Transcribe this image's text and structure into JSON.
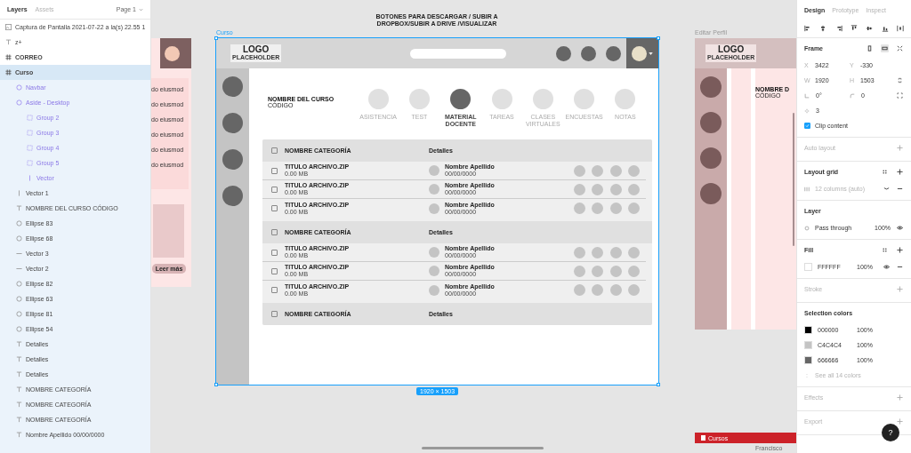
{
  "layers_panel": {
    "tabs": [
      {
        "label": "Layers",
        "selected": true
      },
      {
        "label": "Assets",
        "selected": false
      }
    ],
    "page": "Page 1",
    "layers": [
      {
        "name": "Captura de Pantalla 2021-07-22 a la(s) 22.55 1",
        "kind": "image",
        "selected": false
      },
      {
        "name": "z+",
        "kind": "text",
        "selected": false
      },
      {
        "name": "CORREO",
        "kind": "frame",
        "selected": false
      },
      {
        "name": "Curso",
        "kind": "frame",
        "selected": true,
        "children": [
          {
            "name": "Navbar",
            "kind": "component",
            "selected": false
          },
          {
            "name": "Aside - Desktop",
            "kind": "component",
            "selected": false,
            "children": [
              {
                "name": "Group 2",
                "kind": "group",
                "selected": false
              },
              {
                "name": "Group 3",
                "kind": "group",
                "selected": false
              },
              {
                "name": "Group 4",
                "kind": "group",
                "selected": false
              },
              {
                "name": "Group 5",
                "kind": "group",
                "selected": false
              },
              {
                "name": "Vector",
                "kind": "vector",
                "selected": false
              }
            ]
          },
          {
            "name": "Vector 1",
            "kind": "vector",
            "selected": false
          },
          {
            "name": "NOMBRE DEL CURSO CÓDIGO",
            "kind": "text",
            "selected": false
          },
          {
            "name": "Ellipse 83",
            "kind": "ellipse",
            "selected": false
          },
          {
            "name": "Ellipse 68",
            "kind": "ellipse",
            "selected": false
          },
          {
            "name": "Vector 3",
            "kind": "line",
            "selected": false
          },
          {
            "name": "Vector 2",
            "kind": "line",
            "selected": false
          },
          {
            "name": "Ellipse 82",
            "kind": "ellipse",
            "selected": false
          },
          {
            "name": "Ellipse 63",
            "kind": "ellipse",
            "selected": false
          },
          {
            "name": "Ellipse 81",
            "kind": "ellipse",
            "selected": false
          },
          {
            "name": "Ellipse 54",
            "kind": "ellipse",
            "selected": false
          },
          {
            "name": "Detalles",
            "kind": "text",
            "selected": false
          },
          {
            "name": "Detalles",
            "kind": "text",
            "selected": false
          },
          {
            "name": "Detalles",
            "kind": "text",
            "selected": false
          },
          {
            "name": "NOMBRE CATEGORÍA",
            "kind": "text",
            "selected": false
          },
          {
            "name": "NOMBRE CATEGORÍA",
            "kind": "text",
            "selected": false
          },
          {
            "name": "NOMBRE CATEGORÍA",
            "kind": "text",
            "selected": false
          },
          {
            "name": "Nombre Apellido 00/00/0000",
            "kind": "text",
            "selected": false
          }
        ]
      }
    ]
  },
  "canvas": {
    "annotation": "BOTONES PARA DESCARGAR / SUBIR A DROPBOX/SUBIR A DRIVE /VISUALIZAR",
    "left_frame": {
      "lines": [
        "do eiusmod",
        "do eiusmod",
        "do eiusmod",
        "do eiusmod",
        "do eiusmod",
        "do eiusmod"
      ],
      "button": "Leer más"
    },
    "frame": {
      "name": "Curso",
      "size": "1920 × 1503",
      "selected": true,
      "logo": "LOGO",
      "logo_sub": "PLACEHOLDER",
      "course_title": "NOMBRE DEL CURSO",
      "course_code": "CÓDIGO",
      "sections": [
        {
          "label": "ASISTENCIA",
          "selected": false
        },
        {
          "label": "TEST",
          "selected": false
        },
        {
          "label": "MATERIAL DOCENTE",
          "selected": true
        },
        {
          "label": "TAREAS",
          "selected": false
        },
        {
          "label": "CLASES VIRTUALES",
          "selected": false
        },
        {
          "label": "ENCUESTAS",
          "selected": false
        },
        {
          "label": "NOTAS",
          "selected": false
        }
      ],
      "categories": [
        {
          "name": "NOMBRE CATEGORÍA",
          "details": "Detalles",
          "checked": false,
          "files": [
            {
              "title": "TITULO ARCHIVO.ZIP",
              "size": "0.00 MB",
              "author": "Nombre Apellido",
              "date": "00/00/0000",
              "checked": false
            },
            {
              "title": "TITULO ARCHIVO.ZIP",
              "size": "0.00 MB",
              "author": "Nombre Apellido",
              "date": "00/00/0000",
              "checked": false
            },
            {
              "title": "TITULO ARCHIVO.ZIP",
              "size": "0.00 MB",
              "author": "Nombre Apellido",
              "date": "00/00/0000",
              "checked": false
            }
          ]
        },
        {
          "name": "NOMBRE CATEGORÍA",
          "details": "Detalles",
          "checked": false,
          "files": [
            {
              "title": "TITULO ARCHIVO.ZIP",
              "size": "0.00 MB",
              "author": "Nombre Apellido",
              "date": "00/00/0000",
              "checked": false
            },
            {
              "title": "TITULO ARCHIVO.ZIP",
              "size": "0.00 MB",
              "author": "Nombre Apellido",
              "date": "00/00/0000",
              "checked": false
            },
            {
              "title": "TITULO ARCHIVO.ZIP",
              "size": "0.00 MB",
              "author": "Nombre Apellido",
              "date": "00/00/0000",
              "checked": false
            }
          ]
        },
        {
          "name": "NOMBRE CATEGORÍA",
          "details": "Detalles",
          "checked": false
        }
      ]
    },
    "right_frame": {
      "name": "Editar Perfil",
      "logo": "LOGO",
      "logo_sub": "PLACEHOLDER",
      "title": "NOMBRE D",
      "code": "CÓDIGO"
    },
    "bottom_bar": {
      "label": "Cursos",
      "user": "Francisco"
    }
  },
  "design_panel": {
    "tabs": [
      {
        "label": "Design",
        "selected": true
      },
      {
        "label": "Prototype",
        "selected": false
      },
      {
        "label": "Inspect",
        "selected": false
      }
    ],
    "frame": {
      "title": "Frame",
      "fields": [
        {
          "kind": "label",
          "label": "X",
          "value": "3422"
        },
        {
          "kind": "label",
          "label": "Y",
          "value": "-330"
        },
        {
          "kind": "label",
          "label": "W",
          "value": "1920"
        },
        {
          "kind": "label",
          "label": "H",
          "value": "1503"
        },
        {
          "kind": "rotation",
          "value": "0°"
        },
        {
          "kind": "radius",
          "value": "0"
        },
        {
          "kind": "smoothing",
          "value": "3"
        }
      ],
      "clip_content": {
        "label": "Clip content",
        "checked": true
      }
    },
    "auto_layout": {
      "title": "Auto layout",
      "enabled": false
    },
    "layout_grid": {
      "title": "Layout grid",
      "enabled": true,
      "grid": "12 columns (auto)"
    },
    "layer": {
      "title": "Layer",
      "enabled": true,
      "blend": "Pass through",
      "opacity": "100%"
    },
    "fill": {
      "title": "Fill",
      "enabled": true,
      "hex": "FFFFFF",
      "opacity": "100%",
      "color": "#ffffff"
    },
    "stroke": {
      "title": "Stroke",
      "enabled": false
    },
    "selection_colors": {
      "title": "Selection colors",
      "enabled": true,
      "colors": [
        {
          "hex": "000000",
          "opacity": "100%",
          "color": "#000000"
        },
        {
          "hex": "C4C4C4",
          "opacity": "100%",
          "color": "#c4c4c4"
        },
        {
          "hex": "666666",
          "opacity": "100%",
          "color": "#666666"
        }
      ],
      "more": "See all 14 colors"
    },
    "effects": {
      "title": "Effects",
      "enabled": false
    },
    "export": {
      "title": "Export",
      "enabled": false
    },
    "help": "?"
  }
}
